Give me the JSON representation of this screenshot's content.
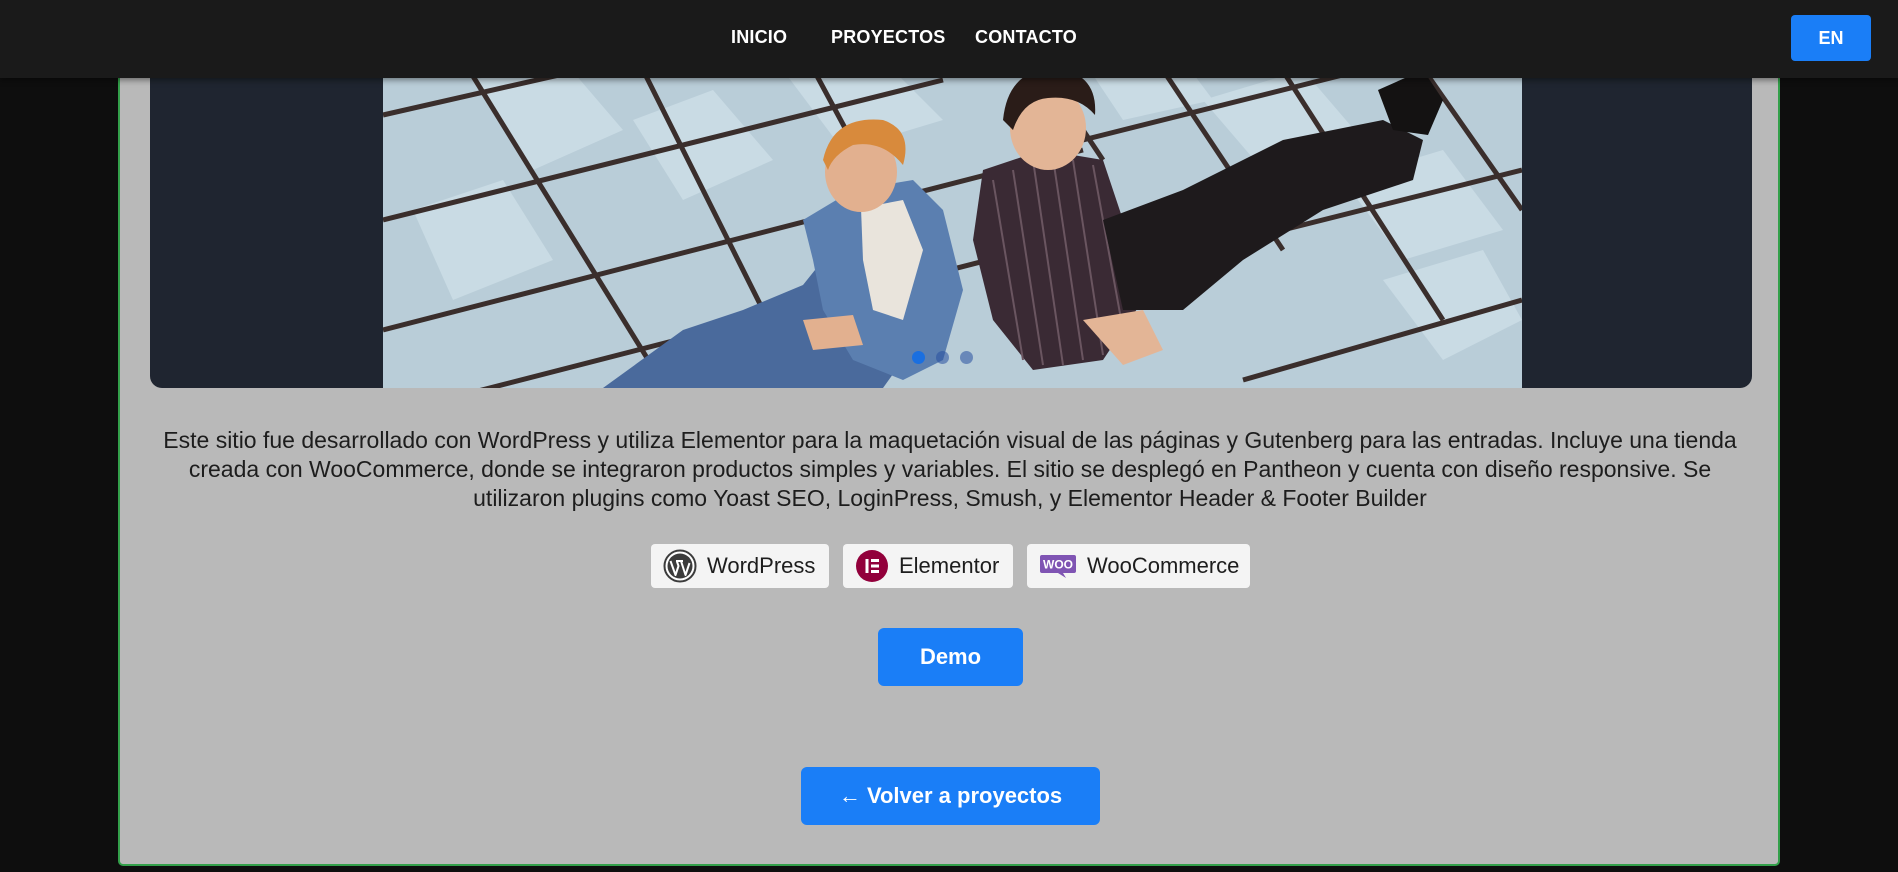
{
  "nav": {
    "links": [
      "INICIO",
      "PROYECTOS",
      "CONTACTO"
    ],
    "lang_button": "EN"
  },
  "carousel": {
    "slide_count": 3,
    "active_slide": 1
  },
  "description": "Este sitio fue desarrollado con WordPress y utiliza Elementor para la maquetación visual de las páginas y Gutenberg para las entradas. Incluye una tienda creada con WooCommerce, donde se integraron productos simples y variables. El sitio se desplegó en Pantheon y cuenta con diseño responsive. Se utilizaron plugins como Yoast SEO, LoginPress, Smush, y Elementor Header & Footer Builder",
  "technologies": [
    {
      "label": "WordPress",
      "icon": "wordpress-icon"
    },
    {
      "label": "Elementor",
      "icon": "elementor-icon"
    },
    {
      "label": "WooCommerce",
      "icon": "woocommerce-icon"
    }
  ],
  "demo_button": "Demo",
  "back_button": "← Volver a proyectos",
  "colors": {
    "accent": "#1a7ef7",
    "card_bg": "#b9b9b9",
    "card_border": "#33a04a",
    "navbar_bg": "#1a1a1a",
    "carousel_bg": "#1f2530"
  }
}
